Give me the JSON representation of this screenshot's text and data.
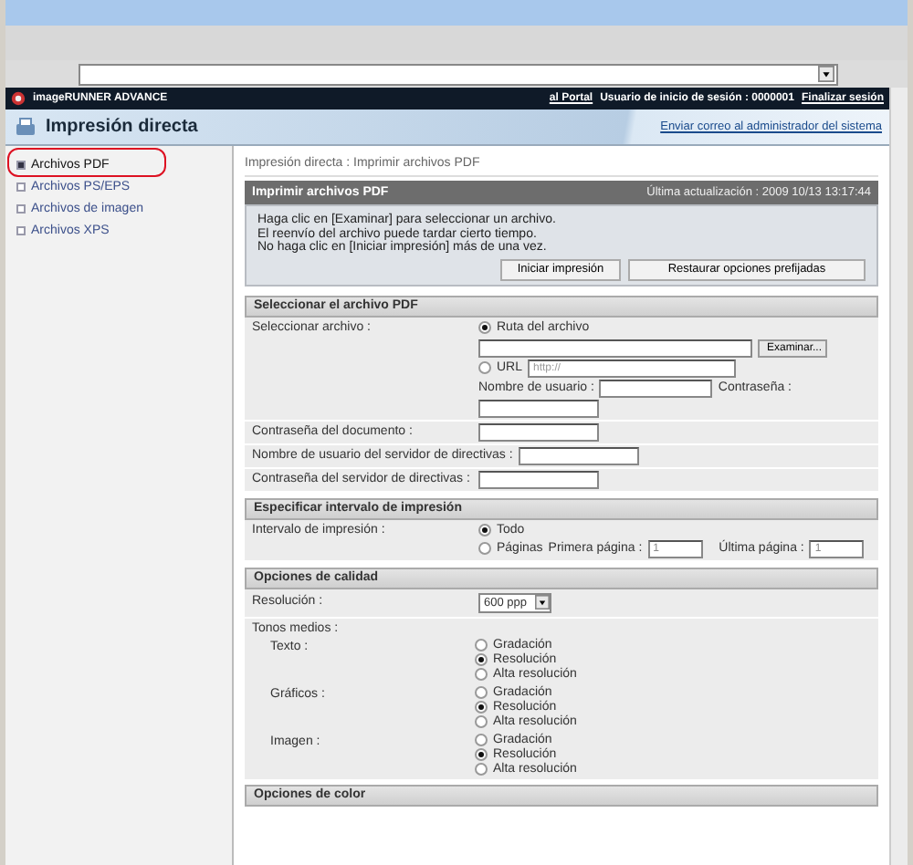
{
  "header": {
    "product": "imageRUNNER ADVANCE",
    "portal_link": "al Portal",
    "user": "Usuario de inicio de sesión : 0000001",
    "logout": "Finalizar sesión"
  },
  "title_bar": {
    "title": "Impresión directa",
    "link": "Enviar correo al administrador del sistema"
  },
  "sidebar": {
    "items": [
      {
        "label": "Archivos PDF",
        "selected": true,
        "circled": true
      },
      {
        "label": "Archivos PS/EPS",
        "selected": false,
        "circled": false
      },
      {
        "label": "Archivos de imagen",
        "selected": false,
        "circled": false
      },
      {
        "label": "Archivos XPS",
        "selected": false,
        "circled": false
      }
    ]
  },
  "breadcrumb": "Impresión directa : Imprimir archivos PDF",
  "panel": {
    "title": "Imprimir archivos PDF",
    "updated": "Última actualización : 2009 10/13 13:17:44",
    "instructions": [
      "Haga clic en [Examinar] para seleccionar un archivo.",
      "El reenvío del archivo puede tardar cierto tiempo.",
      "No haga clic en [Iniciar impresión] más de una vez."
    ],
    "buttons": [
      "Iniciar impresión",
      "Restaurar opciones prefijadas"
    ]
  },
  "sections": [
    {
      "title": "Seleccionar el archivo PDF",
      "rows": [
        {
          "kind": "file",
          "label": "Seleccionar archivo :",
          "options": [
            {
              "label": "Ruta del archivo",
              "selected": true
            },
            {
              "label": "URL",
              "selected": false
            }
          ],
          "browse": "Examinar...",
          "url_placeholder": "http://",
          "user_label": "Nombre de usuario :",
          "password_label": "Contraseña :"
        },
        {
          "kind": "text",
          "label": "Contraseña del documento :"
        },
        {
          "kind": "text",
          "label": "Nombre de usuario del servidor de directivas :"
        },
        {
          "kind": "text",
          "label": "Contraseña del servidor de directivas :"
        }
      ]
    },
    {
      "title": "Especificar intervalo de impresión",
      "rows": [
        {
          "kind": "range",
          "label": "Intervalo de impresión :",
          "options": [
            {
              "label": "Todo",
              "selected": true
            },
            {
              "label": "Páginas",
              "selected": false
            }
          ],
          "first_label": "Primera página :",
          "first_value": "1",
          "last_label": "Última página :",
          "last_value": "1"
        }
      ]
    },
    {
      "title": "Opciones de calidad",
      "rows": [
        {
          "kind": "select",
          "label": "Resolución :",
          "value": "600 ppp"
        },
        {
          "kind": "heading",
          "label": "Tonos medios :"
        },
        {
          "kind": "radio",
          "label": "Texto :",
          "options": [
            {
              "label": "Gradación",
              "selected": false
            },
            {
              "label": "Resolución",
              "selected": true
            },
            {
              "label": "Alta resolución",
              "selected": false
            }
          ]
        },
        {
          "kind": "radio",
          "label": "Gráficos :",
          "options": [
            {
              "label": "Gradación",
              "selected": false
            },
            {
              "label": "Resolución",
              "selected": true
            },
            {
              "label": "Alta resolución",
              "selected": false
            }
          ]
        },
        {
          "kind": "radio",
          "label": "Imagen :",
          "options": [
            {
              "label": "Gradación",
              "selected": false
            },
            {
              "label": "Resolución",
              "selected": true
            },
            {
              "label": "Alta resolución",
              "selected": false
            }
          ]
        }
      ]
    },
    {
      "title": "Opciones de color"
    }
  ]
}
